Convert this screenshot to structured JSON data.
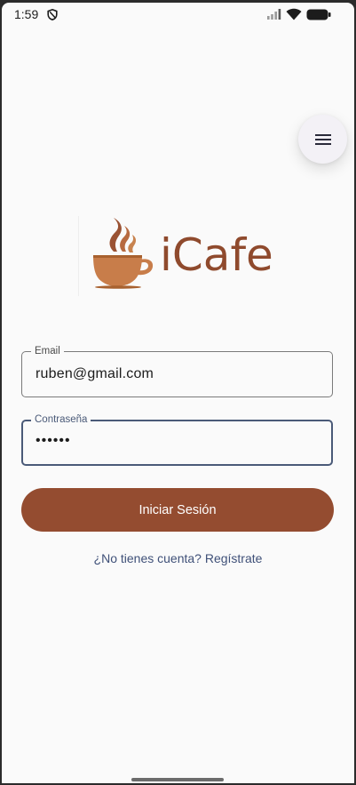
{
  "status_bar": {
    "time": "1:59",
    "icons": [
      "shield-icon",
      "cell-signal-icon",
      "wifi-icon",
      "battery-icon"
    ]
  },
  "menu": {
    "icon": "hamburger-menu-icon"
  },
  "logo": {
    "text": "iCafe",
    "icon": "coffee-cup-steam-icon",
    "color": "#8f4a2d"
  },
  "form": {
    "email": {
      "label": "Email",
      "value": "ruben@gmail.com"
    },
    "password": {
      "label": "Contraseña",
      "value": "••••••"
    },
    "submit_label": "Iniciar Sesión",
    "register_link": "¿No tienes cuenta? Regístrate"
  },
  "colors": {
    "primary": "#944c30",
    "link": "#3f5078",
    "focus_border": "#4a5a78",
    "background": "#fafafa"
  }
}
